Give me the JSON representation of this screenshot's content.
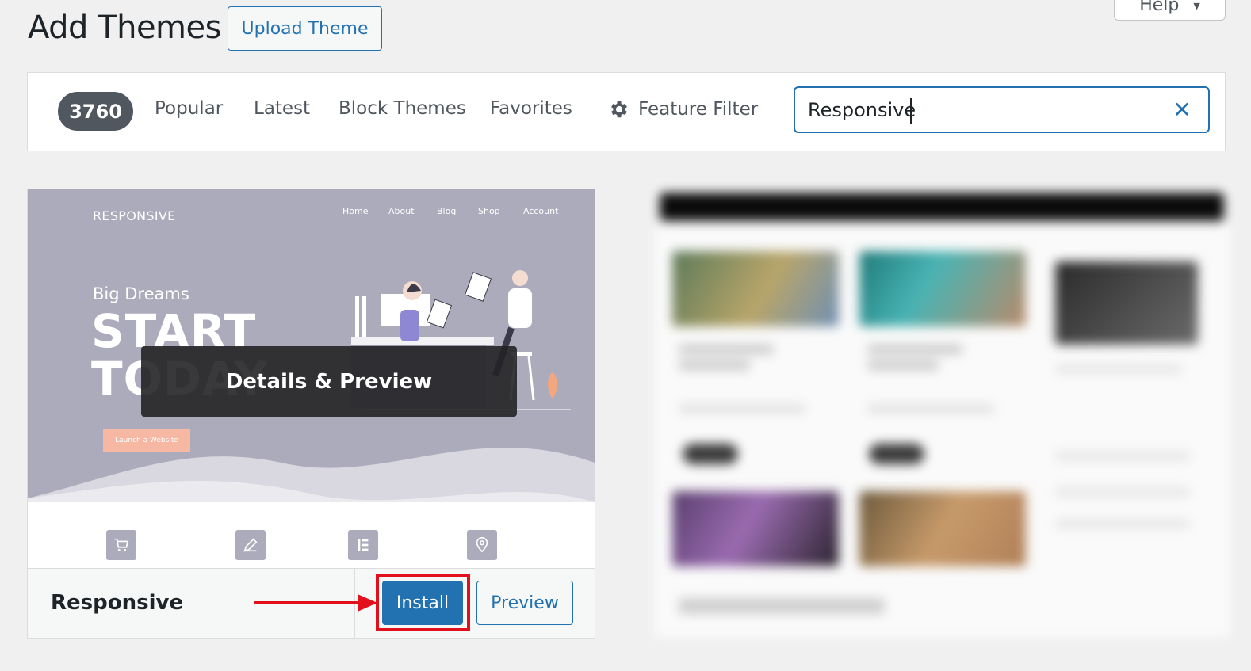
{
  "header": {
    "title": "Add Themes",
    "upload_label": "Upload Theme",
    "help_label": "Help"
  },
  "filter_bar": {
    "count": "3760",
    "links": [
      "Popular",
      "Latest",
      "Block Themes",
      "Favorites"
    ],
    "feature_filter_label": "Feature Filter",
    "search_value": "Responsive"
  },
  "theme_card": {
    "name": "Responsive",
    "overlay_label": "Details & Preview",
    "install_label": "Install",
    "preview_label": "Preview",
    "screenshot": {
      "logo": "RESPONSIVE",
      "nav": [
        "Home",
        "About",
        "Blog",
        "Shop",
        "Account"
      ],
      "subheading": "Big Dreams",
      "headline_1": "START",
      "headline_2": "TODAY",
      "cta": "Launch a Website"
    }
  },
  "colors": {
    "accent": "#2271b1",
    "highlight": "#e2101a",
    "count_badge": "#50575e"
  },
  "icons": [
    "gear-icon",
    "close-icon",
    "chevron-down-icon",
    "cart-icon",
    "pen-icon",
    "elementor-icon",
    "location-icon"
  ]
}
